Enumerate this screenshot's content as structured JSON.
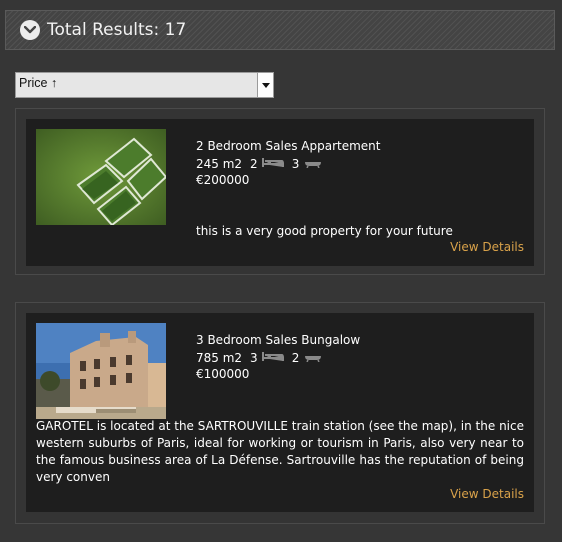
{
  "header": {
    "title": "Total Results: 17",
    "toggle_icon": "chevron-down-circle-icon"
  },
  "sort": {
    "selected": "Price ↑",
    "arrow_icon": "triangle-down-icon"
  },
  "listings": [
    {
      "title": "2 Bedroom Sales Appartement",
      "area": "245 m2",
      "bedrooms": "2",
      "bathrooms": "3",
      "price": "€200000",
      "description": "this is a very good property for your future",
      "link": "View Details",
      "image_icon": "aerial-fields-image"
    },
    {
      "title": "3 Bedroom Sales Bungalow",
      "area": "785 m2",
      "bedrooms": "3",
      "bathrooms": "2",
      "price": "€100000",
      "description": "GAROTEL is located at the SARTROUVILLE train station (see the map), in the nice western suburbs of Paris, ideal for working or tourism in Paris, also very near to the famous business area of La Défense. Sartrouville has the reputation of being very conven",
      "link": "View Details",
      "image_icon": "stone-house-image"
    }
  ],
  "colors": {
    "link": "#d9a24a",
    "card_bg": "#1e1e1e",
    "page_bg": "#363636"
  }
}
